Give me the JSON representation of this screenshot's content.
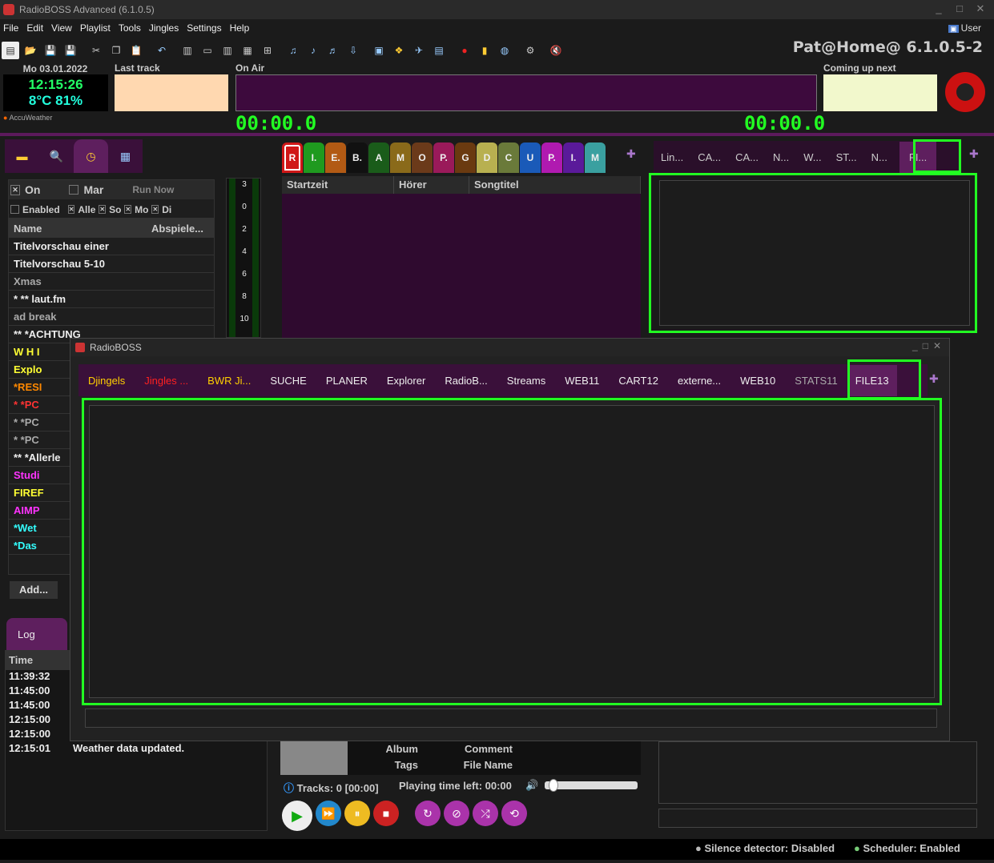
{
  "window": {
    "title": "RadioBOSS Advanced (6.1.0.5)",
    "user": "User"
  },
  "menu": [
    "File",
    "Edit",
    "View",
    "Playlist",
    "Tools",
    "Jingles",
    "Settings",
    "Help"
  ],
  "station": "Pat@Home@ 6.1.0.5-2",
  "clock": {
    "date": "Mo 03.01.2022",
    "time": "12:15:26",
    "weather": "8°C 81%",
    "provider": "AccuWeather"
  },
  "labels": {
    "last_track": "Last track",
    "on_air": "On Air",
    "coming_up": "Coming up next"
  },
  "timers": {
    "elapsed": "00:00.0",
    "remaining": "00:00.0"
  },
  "scheduler": {
    "on_label": "On",
    "mar_label": "Mar",
    "run_now": "Run Now",
    "filter": {
      "enabled": "Enabled",
      "alle": "Alle",
      "so": "So",
      "mo": "Mo",
      "di": "Di"
    },
    "col_name": "Name",
    "col_play": "Abspiele...",
    "rows": [
      {
        "name": "Titelvorschau einer",
        "color": "#eeeeee"
      },
      {
        "name": "Titelvorschau 5-10",
        "color": "#eeeeee"
      },
      {
        "name": "Xmas",
        "color": "#aaaaaa"
      },
      {
        "name": "* ** laut.fm",
        "color": "#eeeeee"
      },
      {
        "name": "ad break",
        "color": "#aaaaaa"
      },
      {
        "name": "** *ACHTUNG",
        "color": "#eeeeee"
      },
      {
        "name": "W H I",
        "color": "#ffff33"
      },
      {
        "name": "Explo",
        "color": "#ffff33"
      },
      {
        "name": "*RESI",
        "color": "#ff8800"
      },
      {
        "name": "* *PC",
        "color": "#ff3333"
      },
      {
        "name": "* *PC",
        "color": "#aaaaaa"
      },
      {
        "name": "* *PC",
        "color": "#aaaaaa"
      },
      {
        "name": "** *Allerle",
        "color": "#eeeeee"
      },
      {
        "name": "Studi",
        "color": "#ff33ff"
      },
      {
        "name": "FIREF",
        "color": "#ffff33"
      },
      {
        "name": "AIMP",
        "color": "#ff33ff"
      },
      {
        "name": "*Wet",
        "color": "#33ffff"
      },
      {
        "name": "*Das",
        "color": "#33ffff"
      }
    ],
    "add_button": "Add..."
  },
  "vu_ticks": [
    "3",
    "0",
    "2",
    "4",
    "6",
    "8",
    "10"
  ],
  "log": {
    "tab": "Log",
    "col_time": "Time",
    "entries": [
      {
        "time": "11:39:32",
        "msg": ""
      },
      {
        "time": "11:45:00",
        "msg": ""
      },
      {
        "time": "11:45:00",
        "msg": ""
      },
      {
        "time": "12:15:00",
        "msg": ""
      },
      {
        "time": "12:15:00",
        "msg": ""
      },
      {
        "time": "12:15:01",
        "msg": "Weather data updated."
      }
    ]
  },
  "categories": [
    {
      "l": "R",
      "c": "#d01818"
    },
    {
      "l": "I.",
      "c": "#1f9a1f"
    },
    {
      "l": "E.",
      "c": "#b25a14"
    },
    {
      "l": "B.",
      "c": "#111111"
    },
    {
      "l": "A",
      "c": "#1a5c1a"
    },
    {
      "l": "M",
      "c": "#8a6a1a"
    },
    {
      "l": "O",
      "c": "#6b3a1a"
    },
    {
      "l": "P.",
      "c": "#9a1a5a"
    },
    {
      "l": "G",
      "c": "#6a3a10"
    },
    {
      "l": "D",
      "c": "#b8b050"
    },
    {
      "l": "C",
      "c": "#6a7a3a"
    },
    {
      "l": "U",
      "c": "#1a5ab8"
    },
    {
      "l": "P.",
      "c": "#b01ab0"
    },
    {
      "l": "I.",
      "c": "#5a1a9a"
    },
    {
      "l": "M",
      "c": "#3aa0a0"
    }
  ],
  "playlist": {
    "cols": [
      "Startzeit",
      "Hörer",
      "Songtitel"
    ]
  },
  "right_tabs": [
    "Lin...",
    "CA...",
    "CA...",
    "N...",
    "W...",
    "ST...",
    "N...",
    "FI..."
  ],
  "dialog": {
    "title": "RadioBOSS",
    "tabs": [
      {
        "label": "Djingels",
        "color": "#ffd000"
      },
      {
        "label": "Jingles ...",
        "color": "#ff2020"
      },
      {
        "label": "BWR Ji...",
        "color": "#ffd000"
      },
      {
        "label": "SUCHE",
        "color": "#eeeeee"
      },
      {
        "label": "PLANER",
        "color": "#eeeeee"
      },
      {
        "label": "Explorer",
        "color": "#eeeeee"
      },
      {
        "label": "RadioB...",
        "color": "#eeeeee"
      },
      {
        "label": "Streams",
        "color": "#eeeeee"
      },
      {
        "label": "WEB11",
        "color": "#eeeeee"
      },
      {
        "label": "CART12",
        "color": "#eeeeee"
      },
      {
        "label": "externe...",
        "color": "#eeeeee"
      },
      {
        "label": "WEB10",
        "color": "#eeeeee"
      },
      {
        "label": "STATS11",
        "color": "#aaaaaa"
      },
      {
        "label": "FILE13",
        "color": "#eeeeee"
      }
    ]
  },
  "track_info": {
    "album": "Album",
    "tags": "Tags",
    "comment": "Comment",
    "file_name": "File Name"
  },
  "status": {
    "tracks": "Tracks: 0 [00:00]",
    "playing_left": "Playing time left: 00:00",
    "volume": 0.05
  },
  "footer": {
    "silence": "Silence detector: Disabled",
    "scheduler": "Scheduler: Enabled"
  }
}
